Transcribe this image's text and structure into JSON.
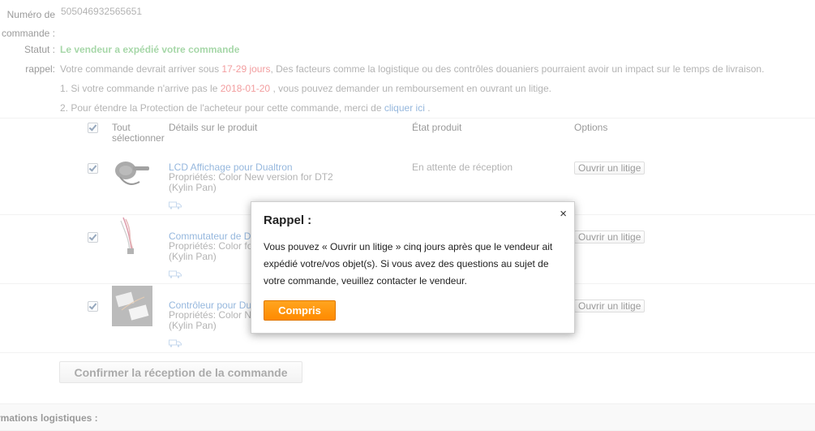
{
  "order": {
    "number_label_line1": "Numéro de",
    "number_label_line2": "commande :",
    "number_value": "505046932565651",
    "status_label": "Statut :",
    "status_value": "Le vendeur a expédié votre commande",
    "reminder_label": "rappel:",
    "reminder_pre": "Votre commande devrait arriver sous ",
    "reminder_days": "17-29 jours",
    "reminder_post": ", Des facteurs comme la logistique ou des contrôles douaniers pourraient avoir un impact sur le temps de livraison.",
    "note1_pre": "1. Si votre commande n'arrive pas le ",
    "note1_date": "2018-01-20",
    "note1_post": " , vous pouvez demander un remboursement en ouvrant un litige.",
    "note2_pre": "2. Pour étendre la Protection de l'acheteur pour cette commande, merci de ",
    "note2_link": "cliquer ici",
    "note2_post": " ."
  },
  "table": {
    "select_all_line1": "Tout",
    "select_all_line2": "sélectionner",
    "col_details": "Détails sur le produit",
    "col_state": "État produit",
    "col_options": "Options",
    "rows": [
      {
        "name": "LCD Affichage pour Dualtron",
        "props": "Propriétés: Color New version for DT2",
        "seller": "(Kylin Pan)",
        "state": "En attente de réception",
        "option": "Ouvrir un litige"
      },
      {
        "name": "Commutateur de D",
        "props": "Propriétés: Color fo",
        "seller": "(Kylin Pan)",
        "state": "",
        "option": "Ouvrir un litige"
      },
      {
        "name": "Contrôleur pour Du",
        "props": "Propriétés: Color N",
        "seller": "(Kylin Pan)",
        "state": "",
        "option": "Ouvrir un litige"
      }
    ]
  },
  "confirm_button": "Confirmer la réception de la commande",
  "logistics_header": "rmations logistiques :",
  "dialog": {
    "title": "Rappel :",
    "close": "×",
    "message": "Vous pouvez « Ouvrir un litige » cinq jours après que le vendeur ait expédié votre/vos objet(s). Si vous avez des questions au sujet de votre commande, veuillez contacter le vendeur.",
    "ok_button": "Compris"
  },
  "colors": {
    "accent": "#ff8a00",
    "link": "#2a6ebb",
    "success": "#4caf50",
    "warning": "#e4393c"
  },
  "icons": [
    "checkbox-checked-icon",
    "truck-icon",
    "close-icon"
  ]
}
